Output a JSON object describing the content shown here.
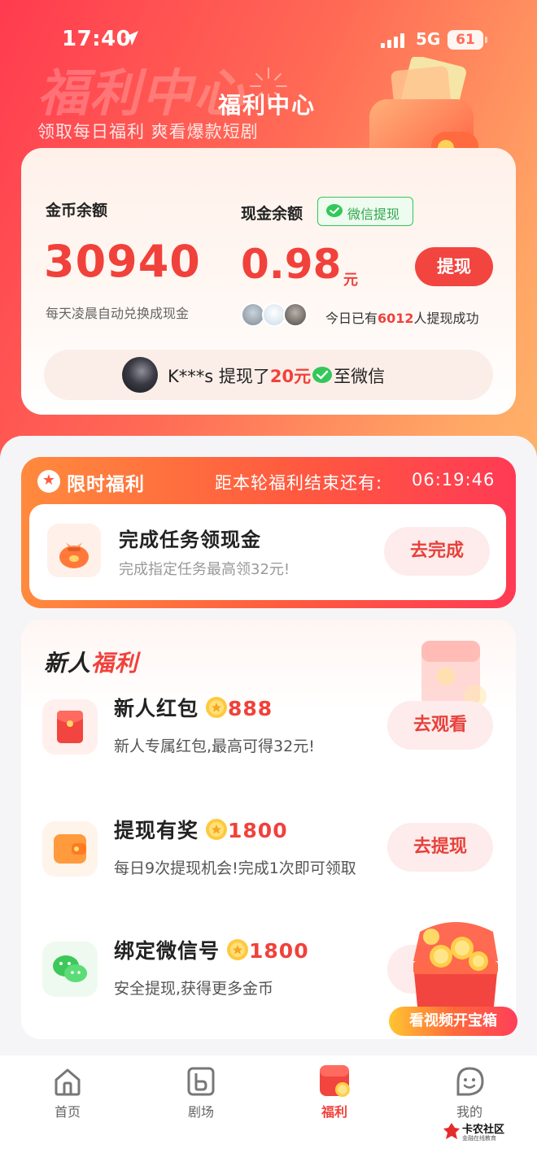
{
  "status_bar": {
    "time": "17:40",
    "network": "5G",
    "battery": "61"
  },
  "header": {
    "watermark": "福利中心",
    "title": "福利中心",
    "subtitle": "领取每日福利 爽看爆款短剧"
  },
  "balance": {
    "coin_label": "金币余额",
    "coin_value": "30940",
    "coin_note": "每天凌晨自动兑换成现金",
    "cash_label": "现金余额",
    "wechat_badge": "微信提现",
    "cash_value": "0.98",
    "cash_unit": "元",
    "withdraw_label": "提现",
    "success_prefix": "今日已有",
    "success_count": "6012",
    "success_suffix": "人提现成功",
    "ticker": {
      "user": "K***s",
      "action": " 提现了",
      "amount": "20元",
      "suffix": "至微信"
    }
  },
  "limited": {
    "title": "限时福利",
    "countdown_label": "距本轮福利结束还有:",
    "countdown": "06:19:46",
    "task_title": "完成任务领现金",
    "task_desc": "完成指定任务最高领32元!",
    "task_button": "去完成"
  },
  "newbie": {
    "title_prefix": "新人",
    "title_accent": "福利",
    "items": [
      {
        "title": "新人红包",
        "points": "888",
        "desc": "新人专属红包,最高可得32元!",
        "button": "去观看",
        "icon": "red-envelope-icon"
      },
      {
        "title": "提现有奖",
        "points": "1800",
        "desc": "每日9次提现机会!完成1次即可领取",
        "button": "去提现",
        "icon": "wallet-icon"
      },
      {
        "title": "绑定微信号",
        "points": "1800",
        "desc": "安全提现,获得更多金币",
        "button": "",
        "icon": "wechat-icon"
      }
    ]
  },
  "treasure": {
    "label": "看视频开宝箱"
  },
  "tabs": [
    {
      "label": "首页",
      "icon": "home-icon"
    },
    {
      "label": "剧场",
      "icon": "theater-icon"
    },
    {
      "label": "福利",
      "icon": "welfare-icon",
      "active": true
    },
    {
      "label": "我的",
      "icon": "profile-icon"
    }
  ],
  "watermark_logo": {
    "name": "卡农社区",
    "tagline": "金融在线教育"
  },
  "colors": {
    "accent": "#f1413b",
    "wechat": "#34c759",
    "hero_start": "#ff3b4f",
    "hero_end": "#ffb36a"
  }
}
